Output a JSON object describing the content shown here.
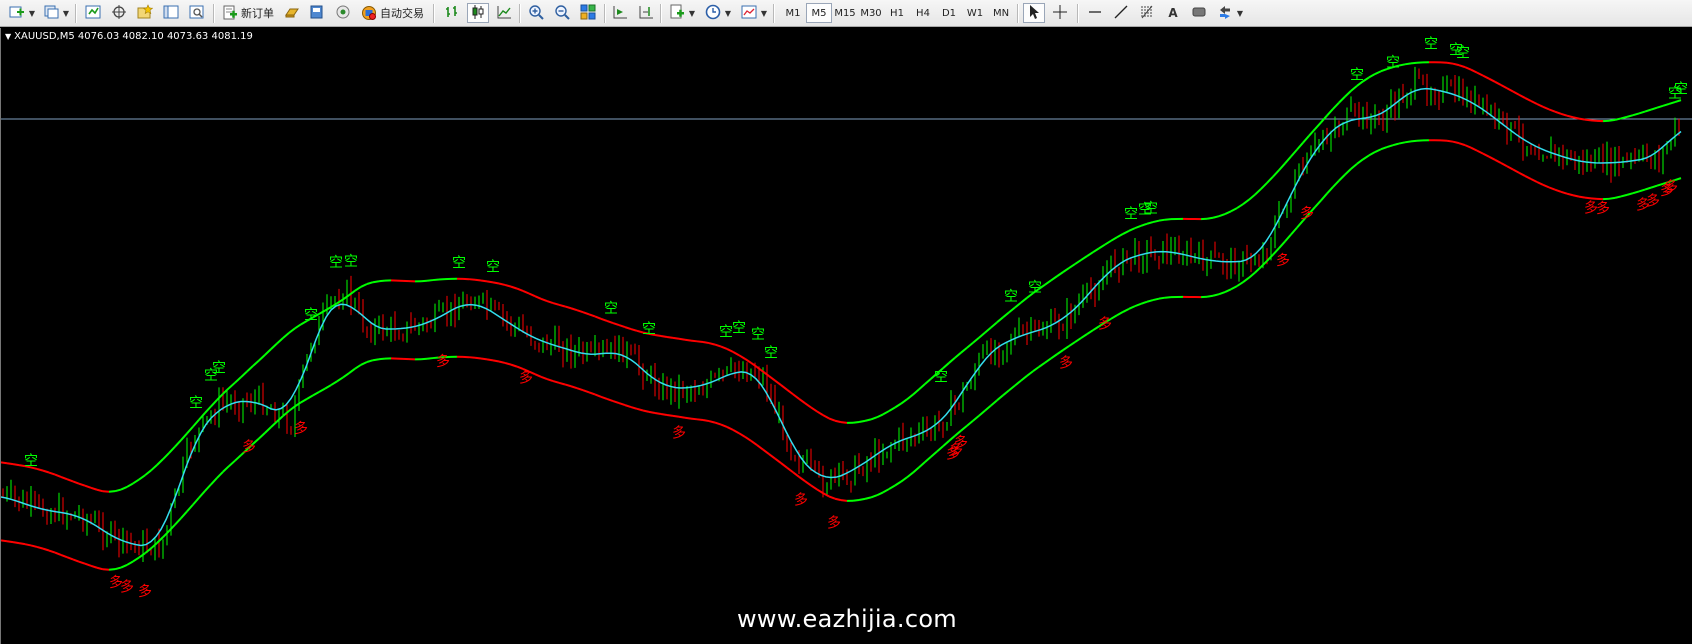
{
  "toolbar": {
    "new_order_label": "新订单",
    "auto_trade_label": "自动交易",
    "timeframes": [
      "M1",
      "M5",
      "M15",
      "M30",
      "H1",
      "H4",
      "D1",
      "W1",
      "MN"
    ],
    "active_timeframe": "M5"
  },
  "chart": {
    "symbol_info": "XAUUSD,M5  4076.03 4082.10 4073.63 4081.19",
    "watermark": "www.eazhijia.com",
    "sell_label": "空",
    "buy_label": "多",
    "colors": {
      "background": "#000000",
      "up_candle": "#00ff00",
      "down_candle": "#ff0000",
      "ma_line": "#33ddee",
      "upper_band_up": "#00ff00",
      "band_down": "#ff0000",
      "price_line": "#7f9fbf"
    }
  },
  "chart_data": {
    "type": "candlestick",
    "symbol": "XAUUSD",
    "timeframe": "M5",
    "last_bar": {
      "open": 4076.03,
      "high": 4082.1,
      "low": 4073.63,
      "close": 4081.19
    },
    "y_axis_labels": "not shown",
    "signals": {
      "sell_count": 28,
      "buy_count": 23
    }
  }
}
